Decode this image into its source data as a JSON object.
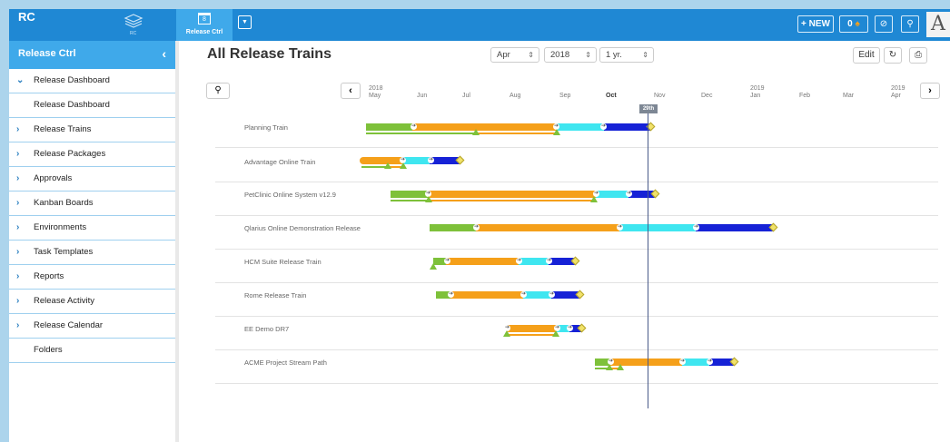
{
  "app": {
    "brand": "RC",
    "layers_label": "RC"
  },
  "topbar": {
    "active_tab_label": "Release Ctrl",
    "new_label": "+ NEW",
    "notif_count": "0",
    "big_letter": "A"
  },
  "sidebar": {
    "title": "Release Ctrl",
    "items": [
      {
        "label": "Release Dashboard",
        "arrow": "⌄"
      },
      {
        "label": "Release Dashboard",
        "arrow": ""
      },
      {
        "label": "Release Trains",
        "arrow": "›"
      },
      {
        "label": "Release Packages",
        "arrow": "›"
      },
      {
        "label": "Approvals",
        "arrow": "›"
      },
      {
        "label": "Kanban Boards",
        "arrow": "›"
      },
      {
        "label": "Environments",
        "arrow": "›"
      },
      {
        "label": "Task Templates",
        "arrow": "›"
      },
      {
        "label": "Reports",
        "arrow": "›"
      },
      {
        "label": "Release Activity",
        "arrow": "›"
      },
      {
        "label": "Release Calendar",
        "arrow": "›"
      },
      {
        "label": "Folders",
        "arrow": ""
      }
    ]
  },
  "main": {
    "title": "All Release Trains",
    "month_select": "Apr",
    "year_select": "2018",
    "range_select": "1 yr.",
    "edit_label": "Edit",
    "today_label": "29th",
    "timeline": [
      {
        "year": "2018",
        "label": "May"
      },
      {
        "year": "",
        "label": "Jun"
      },
      {
        "year": "",
        "label": "Jul"
      },
      {
        "year": "",
        "label": "Aug"
      },
      {
        "year": "",
        "label": "Sep"
      },
      {
        "year": "",
        "label": "Oct"
      },
      {
        "year": "",
        "label": "Nov"
      },
      {
        "year": "",
        "label": "Dec"
      },
      {
        "year": "2019",
        "label": "Jan"
      },
      {
        "year": "",
        "label": "Feb"
      },
      {
        "year": "",
        "label": "Mar"
      },
      {
        "year": "2019",
        "label": "Apr"
      }
    ],
    "trains": [
      {
        "name": "Planning Train"
      },
      {
        "name": "Advantage Online Train"
      },
      {
        "name": "PetClinic Online System v12.9"
      },
      {
        "name": "Qlarius Online Demonstration Release"
      },
      {
        "name": "HCM Suite Release Train"
      },
      {
        "name": "Rome Release Train"
      },
      {
        "name": "EE Demo DR7"
      },
      {
        "name": "ACME Project Stream Path"
      }
    ]
  },
  "colors": {
    "green": "#7ec13a",
    "orange": "#f5a01a",
    "cyan": "#3fe6f0",
    "blue": "#1622d6",
    "topbar": "#1f88d4"
  }
}
